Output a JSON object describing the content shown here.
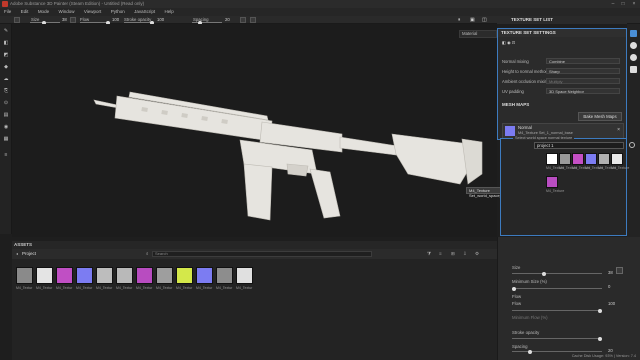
{
  "window": {
    "title": "Adobe Substance 3D Painter (Steam Edition) - Untitled (Read only)"
  },
  "menu": [
    "File",
    "Edit",
    "Mode",
    "Window",
    "Viewport",
    "Python",
    "JavaScript",
    "Help"
  ],
  "toolbar": {
    "size_label": "Size",
    "size_value": "38",
    "flow_label": "Flow",
    "flow_value": "100",
    "stroke_label": "Stroke opacity",
    "stroke_value": "100",
    "spacing_label": "Spacing",
    "spacing_value": "20"
  },
  "viewport": {
    "mode": "Material",
    "tooltip": "M4_Texture Set_world_space_normals"
  },
  "texture_set_list": {
    "title": "TEXTURE SET LIST"
  },
  "settings": {
    "title": "TEXTURE SET SETTINGS",
    "rows": [
      {
        "label": "Normal mixing",
        "value": "Combine",
        "dim": false
      },
      {
        "label": "Height to normal method",
        "value": "Sharp",
        "dim": false
      },
      {
        "label": "Ambient occlusion mixing",
        "value": "Multiply",
        "dim": true
      },
      {
        "label": "UV padding",
        "value": "3D Space Neighbor",
        "dim": false
      }
    ],
    "mesh_maps": "MESH MAPS",
    "bake_button": "Bake Mesh Maps",
    "normal": {
      "title": "Normal",
      "file": "M4_Texture Set_1_normal_base"
    }
  },
  "popup": {
    "search": "project 1",
    "tip": "Select world space normal texture",
    "items": [
      {
        "label": "M4_Texture",
        "color": "#ffffff"
      },
      {
        "label": "M4_Texture",
        "color": "#9a9a9a"
      },
      {
        "label": "M4_Texture",
        "color": "#c44fc4"
      },
      {
        "label": "M4_Texture",
        "color": "#7c7cf2"
      },
      {
        "label": "M4_Texture",
        "color": "#b0b0b0"
      },
      {
        "label": "M4_Texture",
        "color": "#e9e9e9"
      },
      {
        "label": "M4_Texture",
        "color": "#b94dc1"
      }
    ]
  },
  "assets": {
    "title": "ASSETS",
    "project": "Project",
    "search_placeholder": "Search",
    "items": [
      {
        "label": "M4_Textur",
        "color": "#8a8a8a"
      },
      {
        "label": "M4_Textur",
        "color": "#e4e4e4"
      },
      {
        "label": "M4_Textur",
        "color": "#c04fc4"
      },
      {
        "label": "M4_Textur",
        "color": "#7c7cf2"
      },
      {
        "label": "M4_Textur",
        "color": "#bdbdbd"
      },
      {
        "label": "M4_Textur",
        "color": "#b9b9b9"
      },
      {
        "label": "M4_Textur",
        "color": "#b84cc0"
      },
      {
        "label": "M4_Textur",
        "color": "#9e9e9e"
      },
      {
        "label": "M4_Textur",
        "color": "#d4e84a"
      },
      {
        "label": "M4_Textur",
        "color": "#7c7cf2"
      },
      {
        "label": "M4_Textur",
        "color": "#8d8d8d"
      },
      {
        "label": "M4_Textur",
        "color": "#e0e0e0"
      }
    ]
  },
  "properties": {
    "size_label": "Size",
    "size_value": "38",
    "min_size_label": "Minimum Size (%)",
    "min_size_value": "0",
    "flow_section": "Flow",
    "flow_label": "Flow",
    "flow_value": "100",
    "min_flow_label": "Minimum Flow (%)",
    "stroke_label": "Stroke opacity",
    "spacing_label": "Spacing",
    "spacing_value": "20"
  },
  "status": {
    "text": "Cache Disk Usage: 93% | Version: 7.4"
  }
}
